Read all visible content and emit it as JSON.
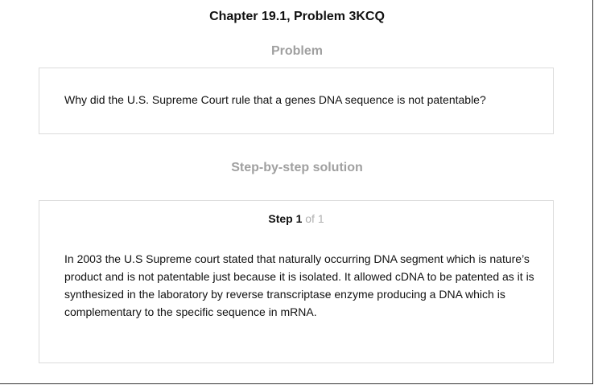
{
  "chapter_title": "Chapter 19.1, Problem 3KCQ",
  "problem": {
    "heading": "Problem",
    "text": "Why did the U.S. Supreme Court rule that a genes DNA sequence is not patentable?"
  },
  "solution": {
    "heading": "Step-by-step solution",
    "step_word": "Step 1",
    "step_of": " of 1",
    "body": "In 2003 the U.S Supreme court stated that naturally occurring DNA segment which is nature’s product and is not patentable just because it is isolated. It allowed cDNA to be patented as it is synthesized in the laboratory by reverse transcriptase enzyme producing a DNA which is complementary to the specific sequence in mRNA."
  },
  "colors": {
    "heading_gray": "#a0a0a0",
    "border": "#dcdcdc",
    "text": "#111111"
  }
}
